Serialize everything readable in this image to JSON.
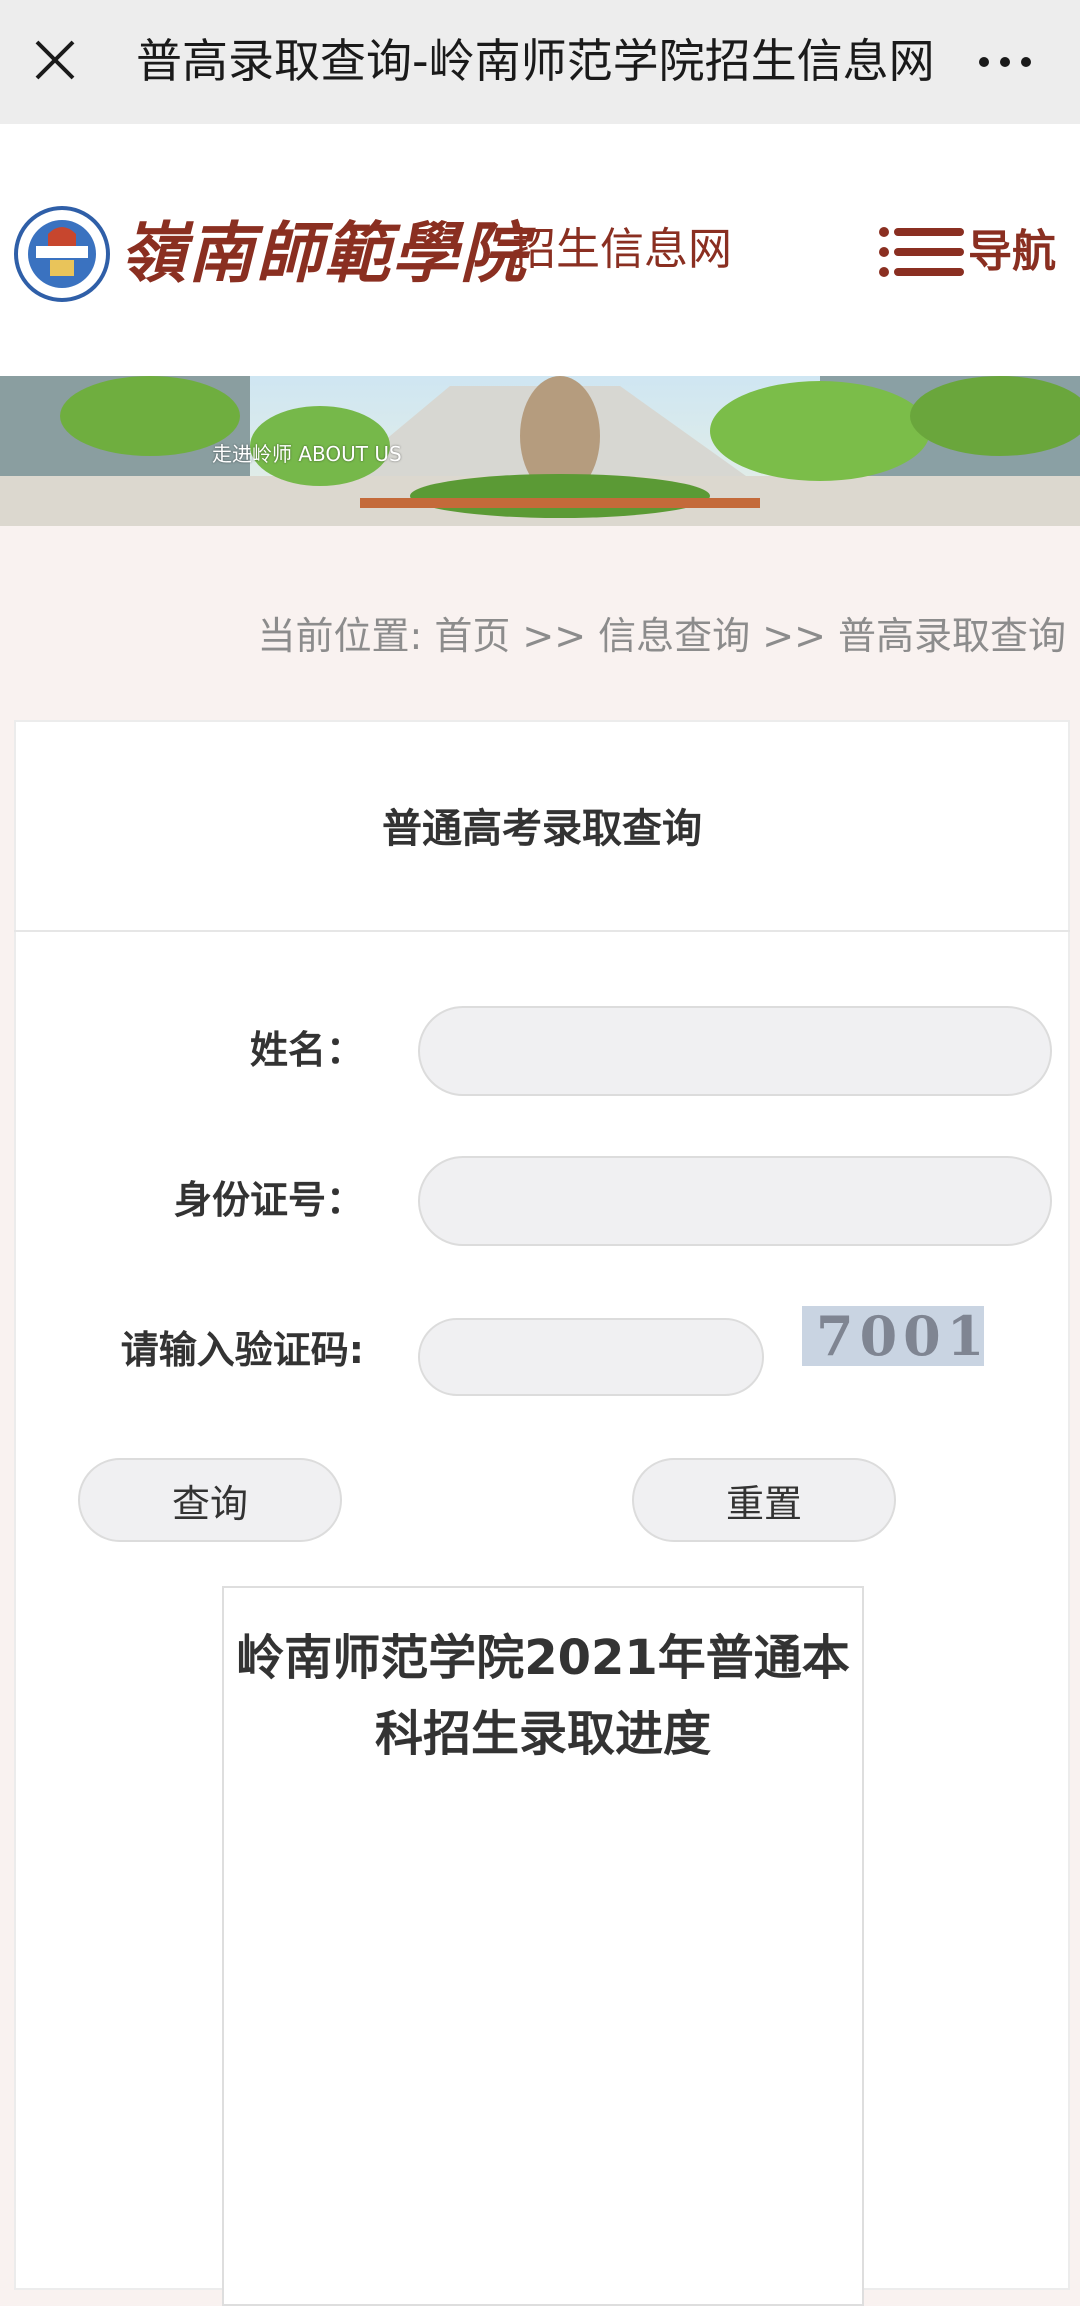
{
  "window": {
    "title": "普高录取查询-岭南师范学院招生信息网",
    "close_icon": "close-icon",
    "more_icon": "more-icon"
  },
  "header": {
    "emblem_icon": "school-emblem-icon",
    "school_name": "嶺南師範學院",
    "site_name": "招生信息网",
    "nav_label": "导航",
    "nav_icon": "menu-lines-icon",
    "brand_color": "#8a2f21"
  },
  "banner": {
    "overlay_text": "走进岭师 ABOUT US"
  },
  "breadcrumb": {
    "text": "当前位置: 首页 >> 信息查询 >> 普高录取查询"
  },
  "form": {
    "title": "普通高考录取查询",
    "name_label": "姓名：",
    "name_value": "",
    "id_label": "身份证号：",
    "id_value": "",
    "captcha_label": "请输入验证码:",
    "captcha_value": "",
    "captcha_image_text": "7001",
    "query_button": "查询",
    "reset_button": "重置"
  },
  "progress": {
    "title": "岭南师范学院2021年普通本科招生录取进度"
  }
}
